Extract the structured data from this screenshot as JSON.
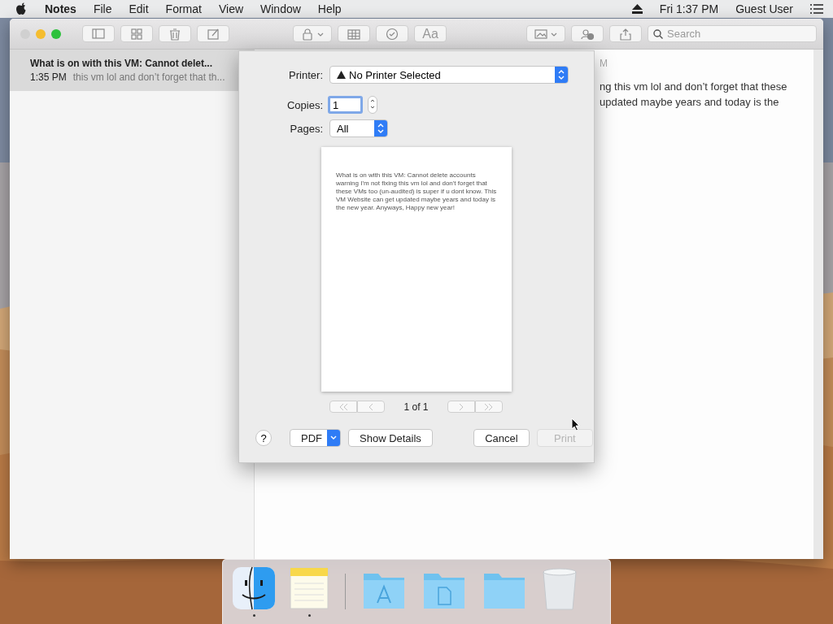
{
  "menu_bar": {
    "app_name": "Notes",
    "menus": [
      "File",
      "Edit",
      "Format",
      "View",
      "Window",
      "Help"
    ],
    "clock": "Fri 1:37 PM",
    "user": "Guest User"
  },
  "toolbar": {
    "format_button": "Aa",
    "search": {
      "placeholder": "Search"
    }
  },
  "notes_list": [
    {
      "title": "What is on with this VM: Cannot delet...",
      "time": "1:35 PM",
      "snippet": "this vm lol and don’t forget that th...",
      "selected": true
    }
  ],
  "note_body": {
    "heading_fragment": "M",
    "lines": [
      "ng this vm lol and don’t forget that these",
      "updated maybe years and today is the"
    ]
  },
  "print_dialog": {
    "printer_label": "Printer:",
    "printer_value": "No Printer Selected",
    "copies_label": "Copies:",
    "copies_value": "1",
    "pages_label": "Pages:",
    "pages_value": "All",
    "preview_text": "What is on with this VM: Cannot delete accounts warning I'm not fixing this vm lol and don't forget that these VMs too (un-audited) is super if u dont know. This VM Website can get updated maybe years and today is the new year. Anyways, Happy new year!",
    "page_indicator": "1 of 1",
    "help": "?",
    "pdf": "PDF",
    "buttons": [
      {
        "label": "Show Details",
        "disabled": false
      },
      {
        "label": "Cancel",
        "disabled": false
      },
      {
        "label": "Print",
        "disabled": true
      }
    ]
  },
  "dock": [
    {
      "kind": "finder",
      "running": true
    },
    {
      "kind": "notes",
      "running": true
    },
    {
      "kind": "separator"
    },
    {
      "kind": "apps-folder",
      "running": false
    },
    {
      "kind": "documents-folder",
      "running": false
    },
    {
      "kind": "folder",
      "running": false
    },
    {
      "kind": "trash",
      "running": false
    }
  ]
}
